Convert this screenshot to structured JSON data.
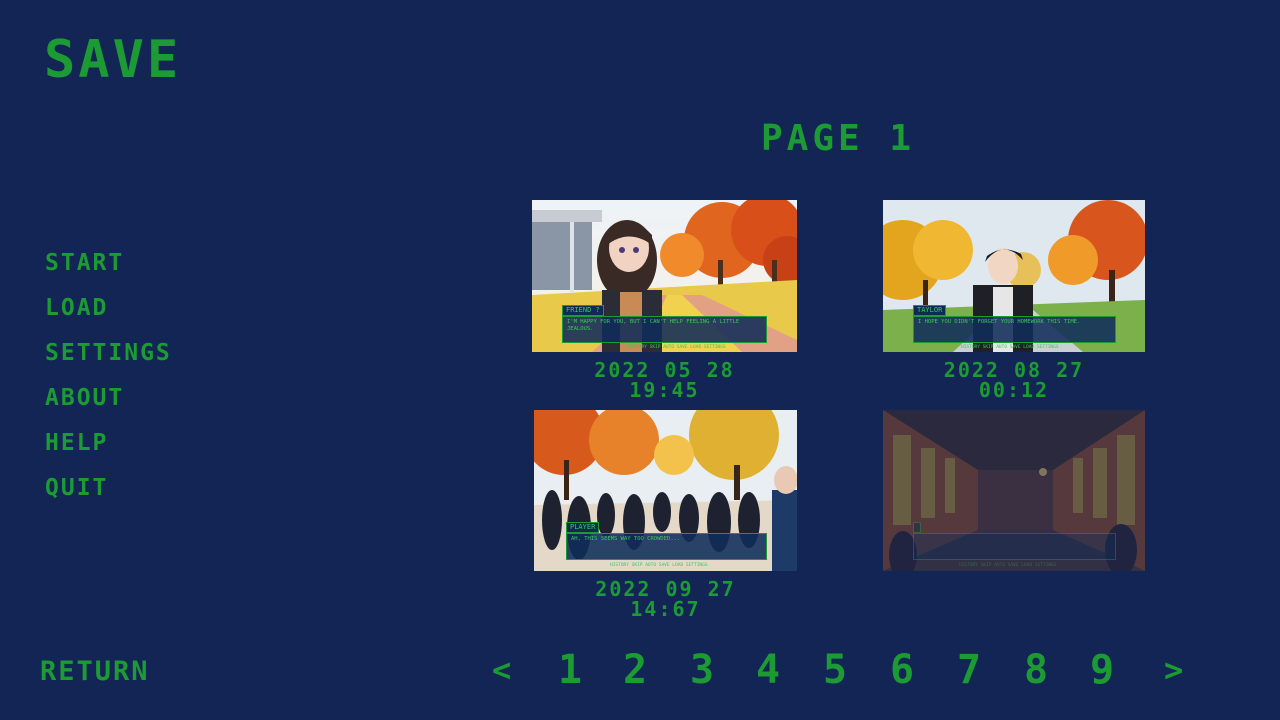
{
  "screen": {
    "title": "SAVE",
    "page_title": "PAGE 1"
  },
  "menu": {
    "items": [
      "START",
      "LOAD",
      "SETTINGS",
      "ABOUT",
      "HELP",
      "QUIT"
    ],
    "return_label": "RETURN"
  },
  "slots": [
    {
      "date": "2022 05 28",
      "time": "19:45",
      "scene": "autumn-walkway-girl",
      "speaker": "FRIEND ?",
      "text": "I'M HAPPY FOR YOU, BUT I CAN'T HELP FEELING A LITTLE JEALOUS.",
      "quick_menu": "HISTORY SKIP AUTO SAVE LOAD SETTINGS"
    },
    {
      "date": "2022 08 27",
      "time": "00:12",
      "scene": "autumn-park-boy",
      "speaker": "TAYLOR",
      "text": "I HOPE YOU DIDN'T FORGET YOUR HOMEWORK THIS TIME.",
      "quick_menu": "HISTORY SKIP AUTO SAVE LOAD SETTINGS"
    },
    {
      "date": "2022 09 27",
      "time": "14:67",
      "scene": "crowded-campus",
      "speaker": "PLAYER",
      "text": "AH, THIS SEEMS WAY TOO CROWDED...",
      "quick_menu": "HISTORY SKIP AUTO SAVE LOAD SETTINGS"
    },
    {
      "date": "",
      "time": "",
      "scene": "school-hallway-dim",
      "speaker": "",
      "text": "",
      "quick_menu": "HISTORY SKIP AUTO SAVE LOAD SETTINGS"
    }
  ],
  "pagination": {
    "prev": "<",
    "pages": [
      "1",
      "2",
      "3",
      "4",
      "5",
      "6",
      "7",
      "8",
      "9"
    ],
    "next": ">",
    "current": "1"
  },
  "colors": {
    "background": "#132555",
    "accent": "#1c9a34"
  }
}
